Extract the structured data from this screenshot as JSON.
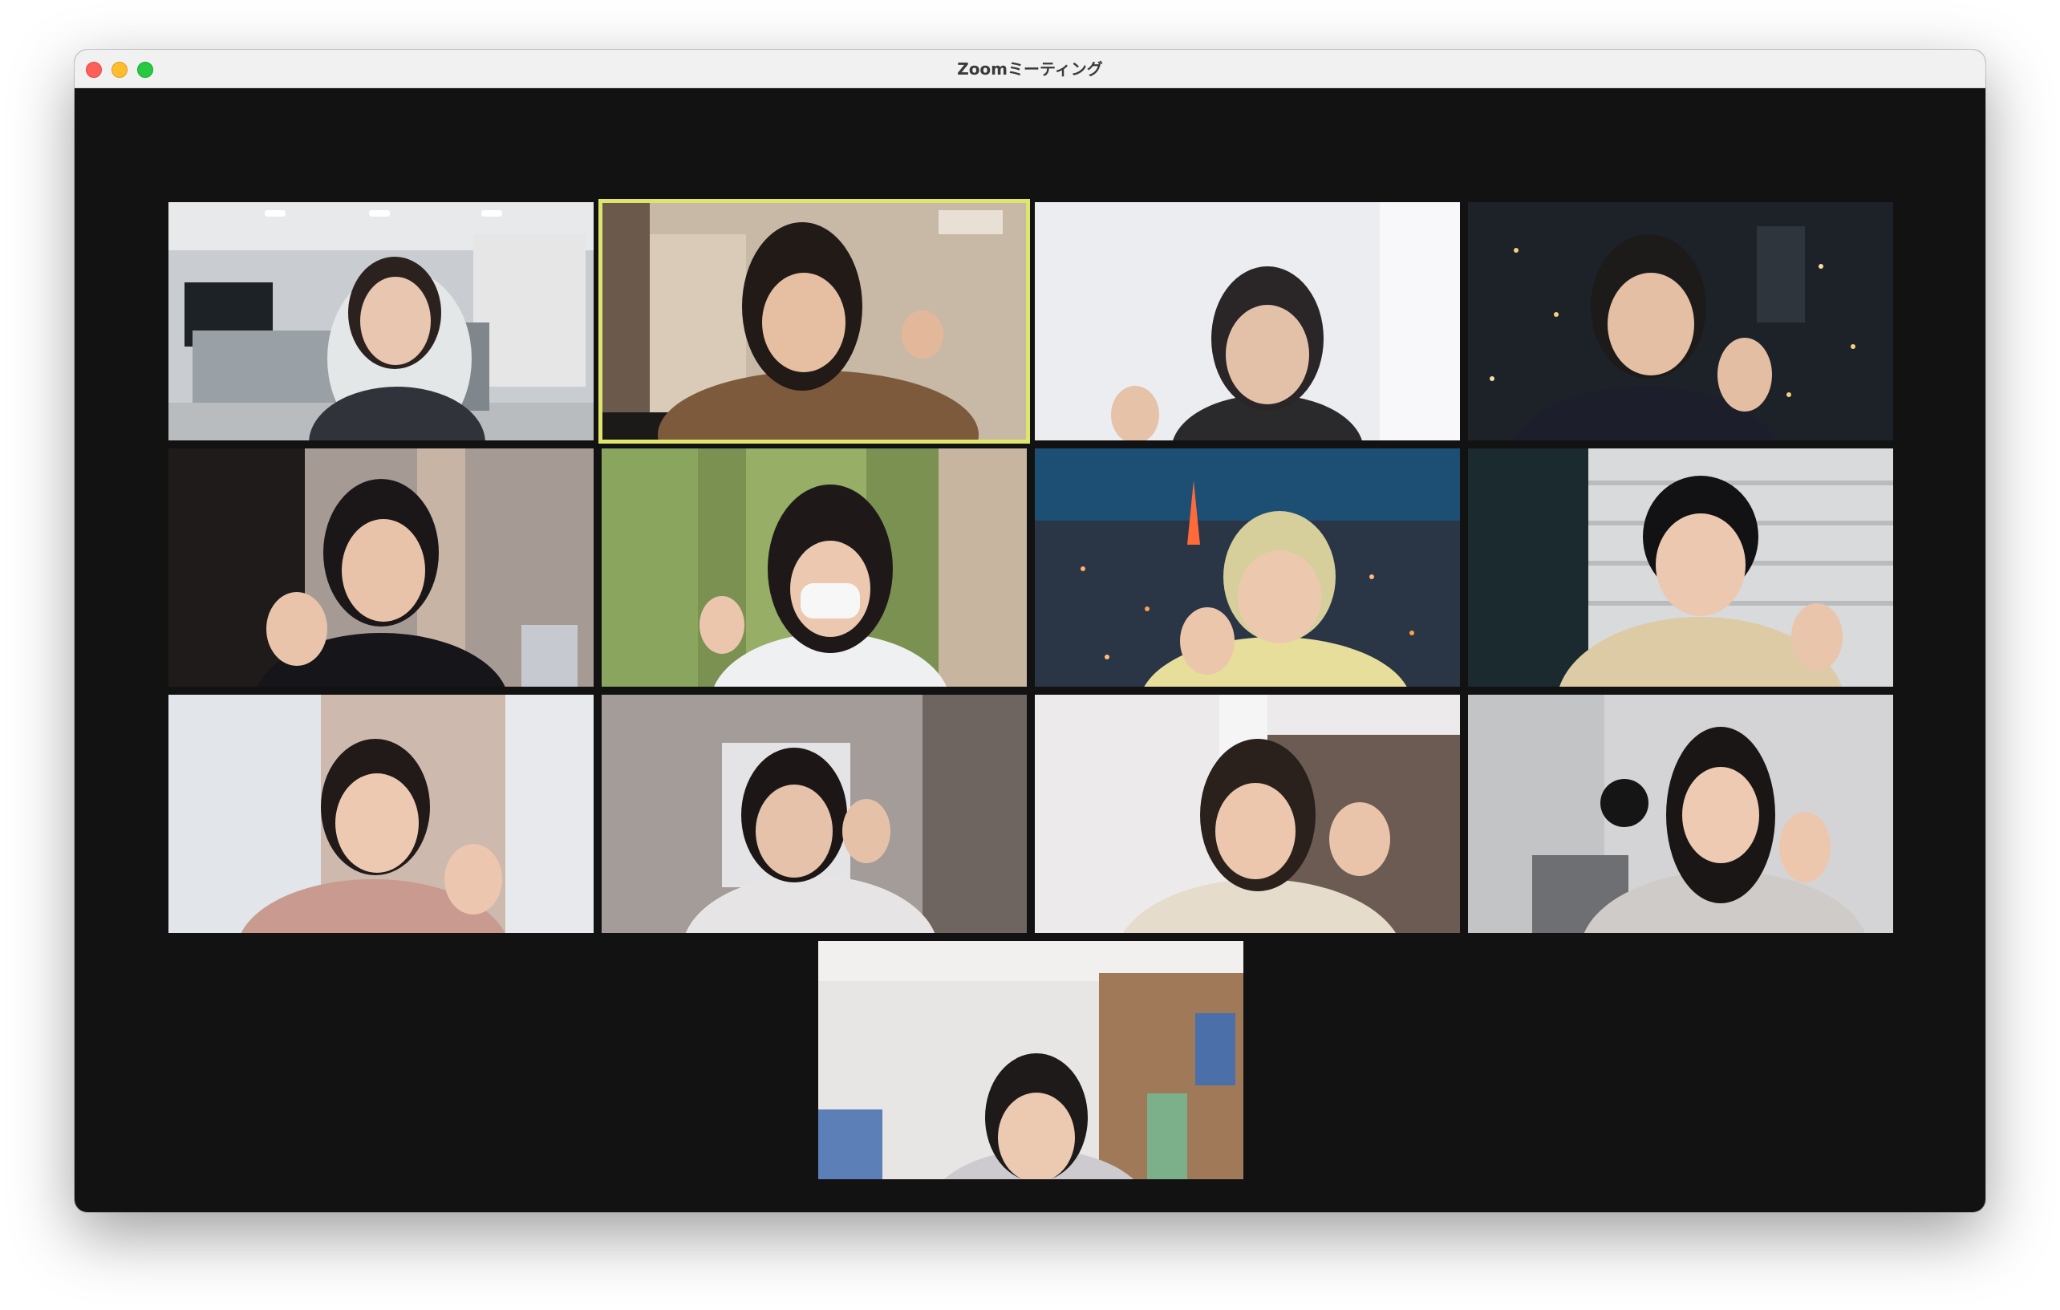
{
  "window": {
    "title": "Zoomミーティング"
  },
  "participants": [
    {
      "scene": "office",
      "active": false
    },
    {
      "scene": "japanese-room",
      "active": true
    },
    {
      "scene": "white-room",
      "active": false
    },
    {
      "scene": "city-night-view",
      "active": false
    },
    {
      "scene": "dark-room-headphones",
      "active": false
    },
    {
      "scene": "green-curtain",
      "active": false
    },
    {
      "scene": "tokyo-tower-night",
      "active": false
    },
    {
      "scene": "blinds-room",
      "active": false
    },
    {
      "scene": "curtain-room",
      "active": false
    },
    {
      "scene": "blurred-room",
      "active": false
    },
    {
      "scene": "bright-room",
      "active": false
    },
    {
      "scene": "grey-room-clock",
      "active": false
    },
    {
      "scene": "room-with-poster",
      "active": false
    }
  ]
}
